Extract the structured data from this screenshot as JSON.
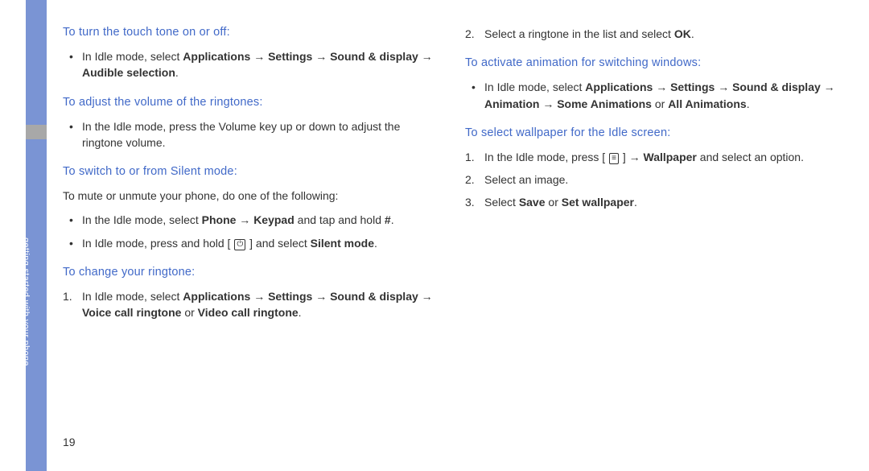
{
  "sidebar": {
    "label": "getting started with your phone"
  },
  "pageNumber": "19",
  "left": {
    "h1": "To turn the touch tone on or off:",
    "b1_pre": "In Idle mode, select ",
    "b1_path": "Applications → Settings → Sound & display → Audible selection",
    "h2": "To adjust the volume of the ringtones:",
    "b2": "In the Idle mode, press the Volume key up or down to adjust the ringtone volume.",
    "h3": "To switch to or from Silent mode:",
    "p3": "To mute or unmute your phone, do one of the following:",
    "b3a_pre": "In the Idle mode, select ",
    "b3a_mid": "Phone → Keypad",
    "b3a_post": " and tap and hold ",
    "b3a_hash": "#",
    "b3b_pre": "In Idle mode, press and hold [ ",
    "b3b_post": " ] and select ",
    "b3b_bold": "Silent mode",
    "h4": "To change your ringtone:",
    "n4_pre": "In Idle mode, select ",
    "n4_path": "Applications → Settings → Sound & display → Voice call ringtone",
    "n4_or": " or ",
    "n4_path2": "Video call ringtone"
  },
  "right": {
    "n1_pre": "Select a ringtone in the list and select ",
    "n1_ok": "OK",
    "h1": "To activate animation for switching windows:",
    "b1_pre": "In Idle mode, select ",
    "b1_path": "Applications → Settings → Sound & display → Animation → Some Animations",
    "b1_or": " or ",
    "b1_path2": "All Animations",
    "h2": "To select wallpaper for the Idle screen:",
    "n2a_pre": "In the Idle mode, press [ ",
    "n2a_post": " ] → ",
    "n2a_wall": "Wallpaper",
    "n2a_end": " and select an option.",
    "n2b": "Select an image.",
    "n2c_pre": "Select ",
    "n2c_save": "Save",
    "n2c_or": " or ",
    "n2c_set": "Set wallpaper"
  }
}
